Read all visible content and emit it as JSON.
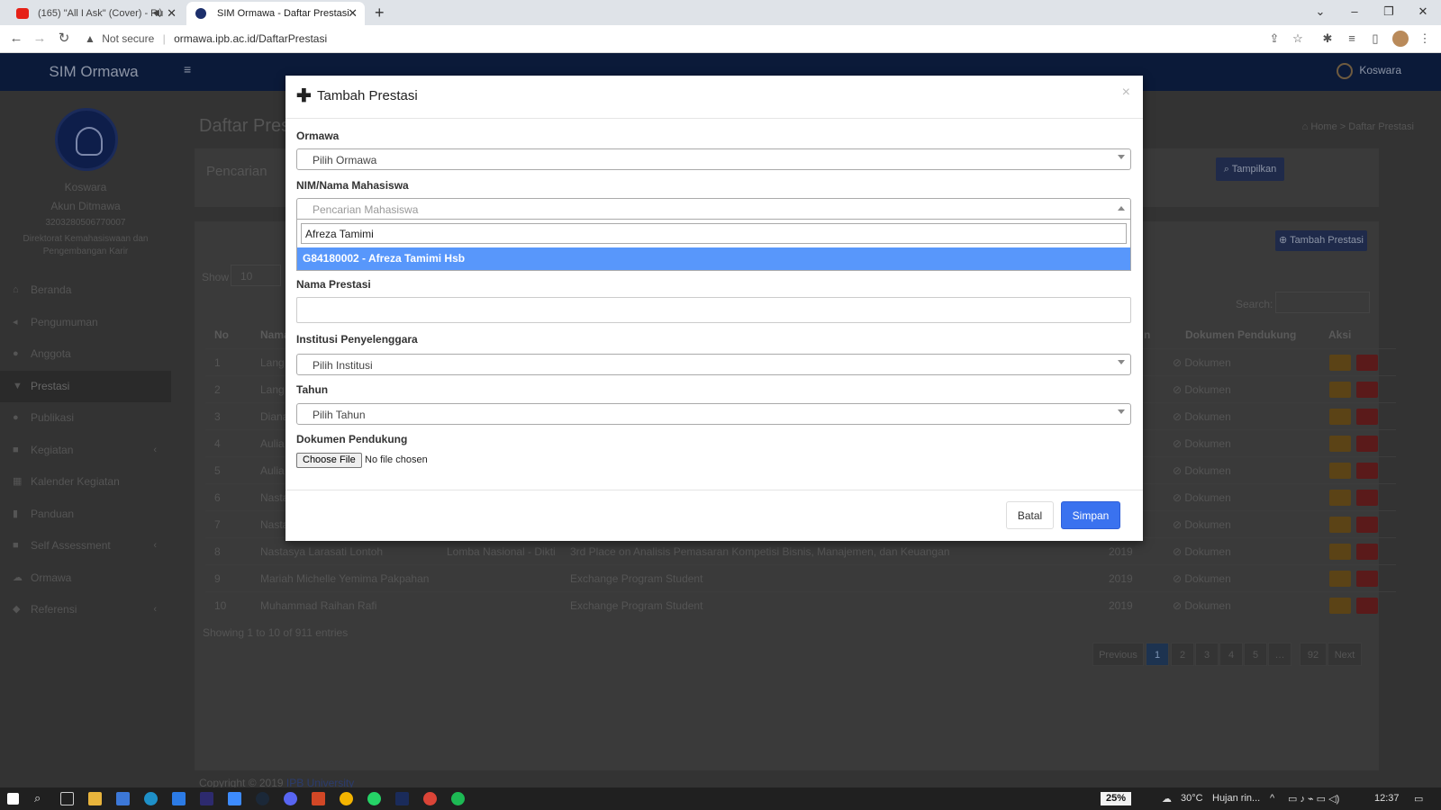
{
  "browser": {
    "tabs": [
      {
        "title": "(165) \"All I Ask\" (Cover) - Ru",
        "favicon": "youtube-icon"
      },
      {
        "title": "SIM Ormawa - Daftar Prestasi",
        "favicon": "ipb-icon"
      }
    ],
    "security_label": "Not secure",
    "url": "ormawa.ipb.ac.id/DaftarPrestasi"
  },
  "header": {
    "brand": "SIM Ormawa",
    "user": "Koswara"
  },
  "sidebar": {
    "name": "Koswara",
    "role": "Akun Ditmawa",
    "nip": "3203280506770007",
    "unit": "Direktorat Kemahasiswaan dan Pengembangan Karir",
    "items": [
      {
        "label": "Beranda",
        "icon": "home-icon"
      },
      {
        "label": "Pengumuman",
        "icon": "bullhorn-icon"
      },
      {
        "label": "Anggota",
        "icon": "users-icon"
      },
      {
        "label": "Prestasi",
        "icon": "trophy-icon"
      },
      {
        "label": "Publikasi",
        "icon": "comments-icon"
      },
      {
        "label": "Kegiatan",
        "icon": "folder-icon"
      },
      {
        "label": "Kalender Kegiatan",
        "icon": "calendar-icon"
      },
      {
        "label": "Panduan",
        "icon": "book-icon"
      },
      {
        "label": "Self Assessment",
        "icon": "folder-icon"
      },
      {
        "label": "Ormawa",
        "icon": "cloud-icon"
      },
      {
        "label": "Referensi",
        "icon": "tags-icon"
      }
    ]
  },
  "page": {
    "title": "Daftar Pres",
    "breadcrumb_home": "Home",
    "breadcrumb_current": "Daftar Prestasi",
    "search_box_title": "Pencarian",
    "tampilkan_label": "Tampilkan",
    "tambah_label": "Tambah Prestasi",
    "show_label": "Show",
    "show_value": "10",
    "search_label": "Search:",
    "info": "Showing 1 to 10 of 911 entries",
    "footer": "Copyright © 2019",
    "footer_link": "IPB University"
  },
  "table": {
    "headers": {
      "no": "No",
      "nama": "Nama",
      "tahun_tail": "n",
      "dokumen": "Dokumen Pendukung",
      "aksi": "Aksi"
    },
    "rows": [
      {
        "no": "1",
        "nama": "Lang",
        "kategori": "",
        "prestasi": "",
        "tahun": "",
        "dok": "Dokumen"
      },
      {
        "no": "2",
        "nama": "Lang",
        "kategori": "",
        "prestasi": "",
        "tahun": "",
        "dok": "Dokumen"
      },
      {
        "no": "3",
        "nama": "Diana",
        "kategori": "",
        "prestasi": "",
        "tahun": "",
        "dok": "Dokumen"
      },
      {
        "no": "4",
        "nama": "Aulia",
        "kategori": "",
        "prestasi": "",
        "tahun": "",
        "dok": "Dokumen"
      },
      {
        "no": "5",
        "nama": "Aulia",
        "kategori": "",
        "prestasi": "",
        "tahun": "",
        "dok": "Dokumen"
      },
      {
        "no": "6",
        "nama": "Nasta",
        "kategori": "",
        "prestasi": "",
        "tahun": "",
        "dok": "Dokumen"
      },
      {
        "no": "7",
        "nama": "Nasta",
        "kategori": "",
        "prestasi": "",
        "tahun": "",
        "dok": "Dokumen"
      },
      {
        "no": "8",
        "nama": "Nastasya Larasati Lontoh",
        "kategori": "Lomba Nasional - Dikti",
        "prestasi": "3rd Place on Analisis Pemasaran Kompetisi Bisnis, Manajemen, dan Keuangan",
        "tahun": "2019",
        "dok": "Dokumen"
      },
      {
        "no": "9",
        "nama": "Mariah Michelle Yemima Pakpahan",
        "kategori": "",
        "prestasi": "Exchange Program Student",
        "tahun": "2019",
        "dok": "Dokumen"
      },
      {
        "no": "10",
        "nama": "Muhammad Raihan Rafi",
        "kategori": "",
        "prestasi": "Exchange Program Student",
        "tahun": "2019",
        "dok": "Dokumen"
      }
    ]
  },
  "pagination": {
    "previous": "Previous",
    "pages": [
      "1",
      "2",
      "3",
      "4",
      "5",
      "…",
      "92"
    ],
    "next": "Next"
  },
  "modal": {
    "title": "Tambah Prestasi",
    "close": "×",
    "ormawa_label": "Ormawa",
    "ormawa_value": "Pilih Ormawa",
    "nim_label": "NIM/Nama Mahasiswa",
    "nim_placeholder": "Pencarian Mahasiswa",
    "nim_search_value": "Afreza Tamimi",
    "nim_result": "G84180002 - Afreza Tamimi Hsb",
    "nama_label": "Nama Prestasi",
    "nama_value": "",
    "institusi_label": "Institusi Penyelenggara",
    "institusi_value": "Pilih Institusi",
    "tahun_label": "Tahun",
    "tahun_value": "Pilih Tahun",
    "dokumen_label": "Dokumen Pendukung",
    "choose_file": "Choose File",
    "no_file": "No file chosen",
    "batal": "Batal",
    "simpan": "Simpan"
  },
  "taskbar": {
    "battery": "25%",
    "temperature": "30°C",
    "weather": "Hujan rin...",
    "time": "12:37"
  },
  "colors": {
    "header_bg": "#0b1a39",
    "primary": "#3a72ef",
    "select_highlight": "#5897fb"
  }
}
